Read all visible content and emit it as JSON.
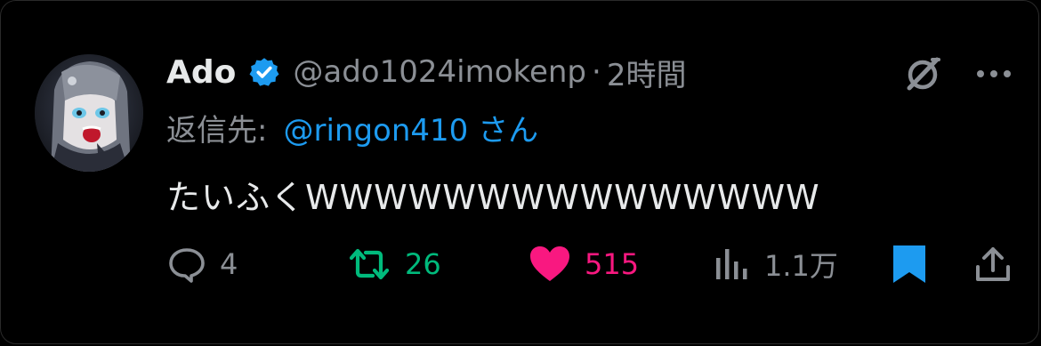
{
  "tweet": {
    "author_name": "Ado",
    "handle": "@ado1024imokenp",
    "separator": "·",
    "time": "2時間",
    "reply_prefix": "返信先:",
    "reply_to": "@ringon410 さん",
    "text": "たいふくWWWWWWWWWWWWWWW"
  },
  "actions": {
    "replies": "4",
    "retweets": "26",
    "likes": "515",
    "views": "1.1万"
  },
  "colors": {
    "background": "#000000",
    "primary_text": "#e7e9ea",
    "secondary_text": "#8b8f95",
    "accent_blue": "#1d9bf0",
    "retweet_green": "#00ba7c",
    "like_pink": "#f91880"
  },
  "icons": {
    "verified": "verified-badge-icon",
    "grok": "grok-icon",
    "more": "more-dots-icon",
    "reply": "reply-bubble-icon",
    "retweet": "retweet-icon",
    "like": "heart-filled-icon",
    "views": "views-bar-chart-icon",
    "bookmark": "bookmark-filled-icon",
    "share": "share-upload-icon"
  }
}
